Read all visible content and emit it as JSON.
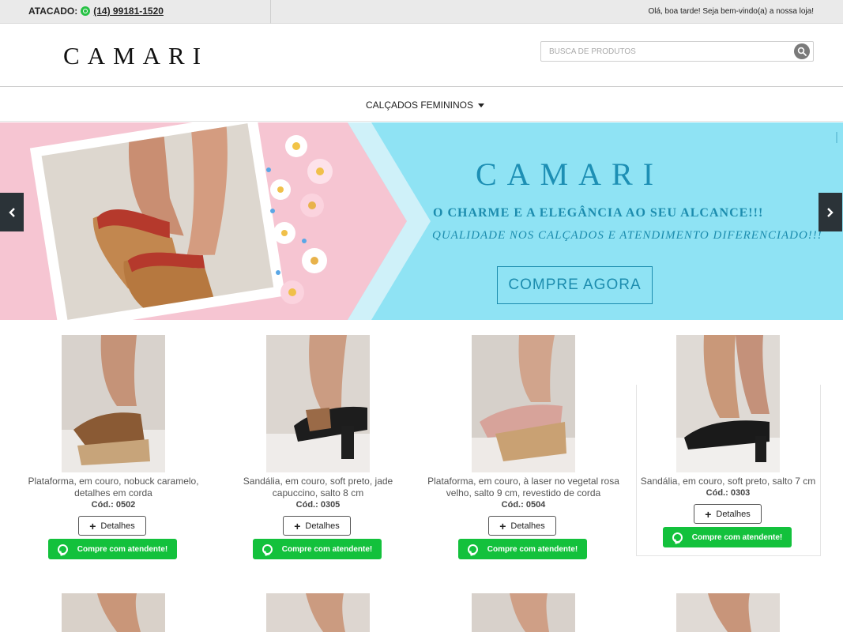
{
  "topbar": {
    "wholesale_label": "ATACADO:",
    "wholesale_phone": "(14) 99181-1520",
    "greeting": "Olá, boa tarde! Seja bem-vindo(a) a nossa loja!"
  },
  "header": {
    "logo": "CAMARI",
    "search_placeholder": "BUSCA DE PRODUTOS"
  },
  "nav": {
    "menu_label": "CALÇADOS FEMININOS"
  },
  "banner": {
    "brand": "CAMARI",
    "tagline_1": "O CHARME E A ELEGÂNCIA AO SEU ALCANCE!!!",
    "tagline_2": "QUALIDADE NOS CALÇADOS E ATENDIMENTO DIFERENCIADO!!!",
    "cta": "COMPRE AGORA",
    "prev_icon": "chevron-left-icon",
    "next_icon": "chevron-right-icon"
  },
  "products": [
    {
      "name": "Plataforma, em couro, nobuck caramelo, detalhes em corda",
      "code": "Cód.: 0502",
      "details": "Detalhes",
      "whatsapp": "Compre com atendente!"
    },
    {
      "name": "Sandália, em couro, soft preto, jade capuccino, salto 8 cm",
      "code": "Cód.: 0305",
      "details": "Detalhes",
      "whatsapp": "Compre com atendente!"
    },
    {
      "name": "Plataforma, em couro, à laser no vegetal rosa velho, salto 9 cm, revestido de corda",
      "code": "Cód.: 0504",
      "details": "Detalhes",
      "whatsapp": "Compre com atendente!"
    },
    {
      "name": "Sandália, em couro, soft preto, salto 7 cm",
      "code": "Cód.: 0303",
      "details": "Detalhes",
      "whatsapp": "Compre com atendente!"
    }
  ],
  "colors": {
    "whatsapp_green": "#13c13c",
    "banner_blue": "#8fe3f4",
    "banner_pink": "#f6c5d2",
    "banner_text": "#1c8cae"
  }
}
